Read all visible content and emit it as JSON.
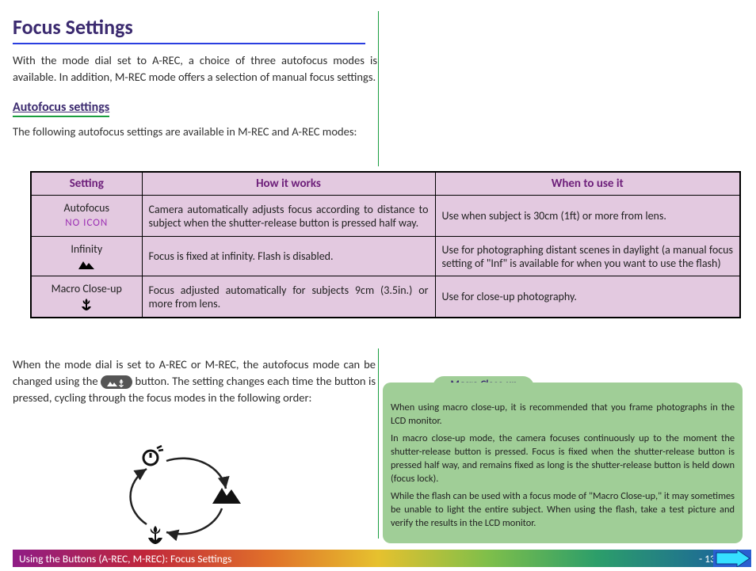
{
  "page": {
    "title": "Focus Settings",
    "intro": "With the mode dial set to A-REC, a choice of three autofocus modes is available.  In addition, M-REC mode offers a selection of manual focus settings.",
    "subhead": "Autofocus settings",
    "sub_intro": "The following autofocus settings are available in M-REC and A-REC modes:",
    "after_table_1": "When the mode dial is set to A-REC or M-REC, the autofocus mode can be changed using the ",
    "after_table_2": " button.  The setting changes each time the button is pressed, cycling through the focus modes in the following order:"
  },
  "table": {
    "headers": {
      "setting": "Setting",
      "how": "How it works",
      "when": "When to use it"
    },
    "rows": [
      {
        "name": "Autofocus",
        "icon_label": "NO ICON",
        "how": "Camera automatically adjusts focus according to distance to subject when the shutter-release button is pressed half way.",
        "when": "Use when subject is 30cm (1ft) or more from lens."
      },
      {
        "name": "Infinity",
        "how": "Focus is fixed at infinity.  Flash is disabled.",
        "when": "Use for photographing distant scenes in daylight (a manual focus setting of \"Inf\" is available for when you want to use the flash)"
      },
      {
        "name": "Macro Close-up",
        "how": "Focus adjusted automatically for subjects 9cm (3.5in.) or more from lens.",
        "when": "Use for close-up photography."
      }
    ]
  },
  "callout": {
    "title": "Macro Close-up",
    "p1": "When using macro close-up, it is recommended that you frame photographs in the LCD monitor.",
    "p2": "In macro close-up mode, the camera focuses continuously up to the moment the shutter-release button is pressed.  Focus is fixed when the shutter-release button is pressed half way, and remains fixed as long is the shutter-release button is held down (focus lock).",
    "p3": "While the flash can be used with a focus mode of \"Macro Close-up,\" it may sometimes be unable to light the entire subject.  When using the flash, take a test picture and verify the results in the LCD monitor."
  },
  "footer": {
    "text": "Using the Buttons (A-REC, M-REC): Focus Settings",
    "page": "- 13 -"
  },
  "icons": {
    "mountain": "mountain-icon",
    "tulip": "tulip-icon",
    "timer": "self-timer-icon",
    "button": "focus-button-icon",
    "next": "next-page-arrow-icon"
  }
}
